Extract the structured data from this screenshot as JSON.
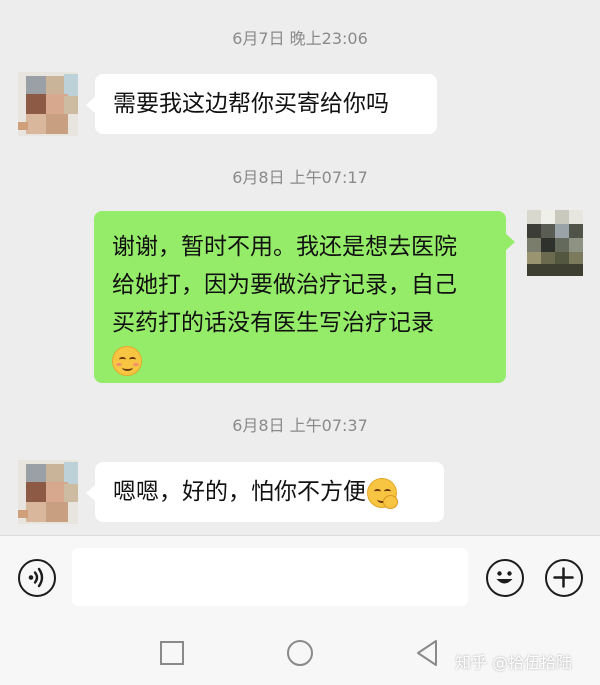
{
  "messages": [
    {
      "timestamp": "6月7日 晚上23:06",
      "direction": "incoming",
      "text": "需要我这边帮你买寄给你吗"
    },
    {
      "timestamp": "6月8日 上午07:17",
      "direction": "outgoing",
      "lines": [
        "谢谢，暂时不用。我还是想去医院",
        "给她打，因为要做治疗记录，自己",
        "买药打的话没有医生写治疗记录"
      ],
      "emoji": "smiling-face-emoji"
    },
    {
      "timestamp": "6月8日 上午07:37",
      "direction": "incoming",
      "text": "嗯嗯，好的，怕你不方便",
      "emoji": "hand-over-mouth-emoji"
    }
  ],
  "input": {
    "placeholder": "",
    "value": ""
  },
  "icons": {
    "voice": "voice-icon",
    "emoji": "emoji-icon",
    "plus": "plus-icon",
    "nav_recent": "recent-apps-icon",
    "nav_home": "home-icon",
    "nav_back": "back-icon"
  },
  "watermark": "知乎 @拾伍拾陆",
  "colors": {
    "background": "#ededed",
    "incoming_bubble": "#ffffff",
    "outgoing_bubble": "#95ec69",
    "timestamp": "#8a8a8a"
  }
}
